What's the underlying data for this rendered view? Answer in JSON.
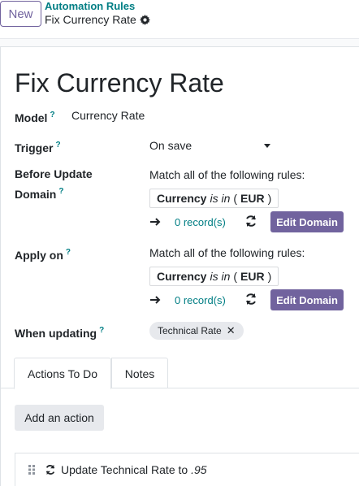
{
  "header": {
    "new_label": "New",
    "breadcrumb_parent": "Automation Rules",
    "breadcrumb_current": "Fix Currency Rate"
  },
  "record": {
    "title": "Fix Currency Rate",
    "model": {
      "label": "Model",
      "help": "?",
      "value": "Currency Rate"
    },
    "trigger": {
      "label": "Trigger",
      "help": "?",
      "value": "On save"
    },
    "before_update": {
      "label_line1": "Before Update",
      "label_line2": "Domain",
      "help": "?",
      "match_text": "Match all of the following rules:",
      "domain_field": "Currency",
      "domain_operator": "is in",
      "domain_open": "(",
      "domain_value": "EUR",
      "domain_close": ")",
      "records": "0 record(s)",
      "edit_label": "Edit Domain"
    },
    "apply_on": {
      "label": "Apply on",
      "help": "?",
      "match_text": "Match all of the following rules:",
      "domain_field": "Currency",
      "domain_operator": "is in",
      "domain_open": "(",
      "domain_value": "EUR",
      "domain_close": ")",
      "records": "0 record(s)",
      "edit_label": "Edit Domain"
    },
    "when_updating": {
      "label": "When updating",
      "help": "?",
      "tag": "Technical Rate",
      "tag_remove": "✕"
    }
  },
  "tabs": [
    {
      "label": "Actions To Do",
      "active": true
    },
    {
      "label": "Notes",
      "active": false
    }
  ],
  "actions": {
    "add_label": "Add an action",
    "items": [
      {
        "text": "Update Technical Rate to",
        "number": ".95",
        "icon": "refresh-icon"
      }
    ]
  },
  "colors": {
    "brand": "#71639e",
    "link": "#017e84",
    "tag_bg": "#e7e9ed"
  }
}
